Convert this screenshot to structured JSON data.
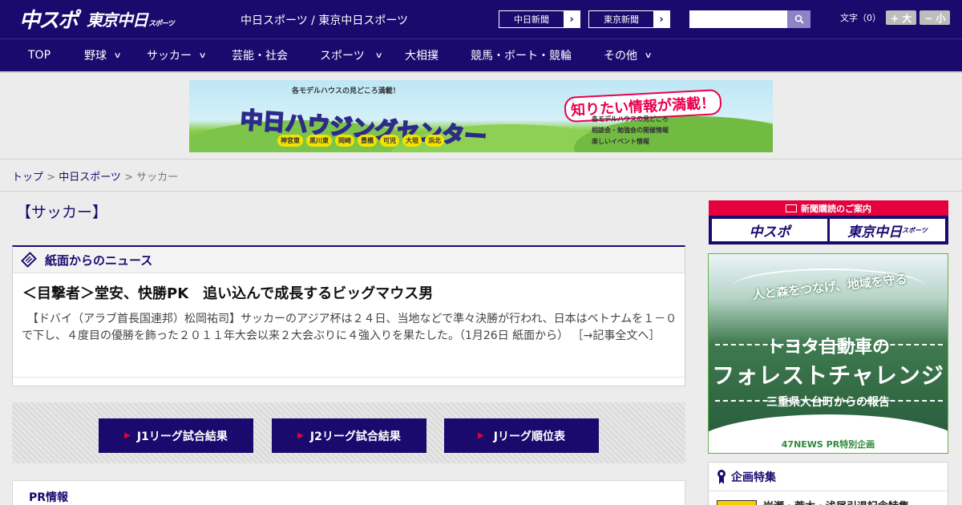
{
  "header": {
    "logo_main": "中スポ",
    "logo_tokyo": "東京中日",
    "logo_tokyo_small": "スポーツ",
    "site_links": "中日スポーツ / 東京中日スポーツ",
    "paper_buttons": [
      "中日新聞",
      "東京新聞"
    ],
    "search_placeholder": "",
    "font_size_label": "文字（0）",
    "font_bigger": "+ 大",
    "font_smaller": "− 小"
  },
  "nav": {
    "items": [
      {
        "label": "TOP",
        "has_dropdown": false
      },
      {
        "label": "野球",
        "has_dropdown": true
      },
      {
        "label": "サッカー",
        "has_dropdown": true
      },
      {
        "label": "芸能・社会",
        "has_dropdown": false
      },
      {
        "label": "スポーツ",
        "has_dropdown": true
      },
      {
        "label": "大相撲",
        "has_dropdown": false
      },
      {
        "label": "競馬・ボート・競輪",
        "has_dropdown": false
      },
      {
        "label": "その他",
        "has_dropdown": true
      }
    ]
  },
  "banner": {
    "subtitle": "各モデルハウスの見どころ満載！",
    "title": "中日ハウジングセンター",
    "catch": "知りたい情報が満載！",
    "cities": [
      "神宮東",
      "黒川東",
      "岡崎",
      "豊橋",
      "可児",
      "大垣",
      "浜北"
    ],
    "info_lines": [
      "各モデルハウスの見どころ",
      "相談会・勉強会の開催情報",
      "楽しいイベント情報"
    ]
  },
  "breadcrumb": {
    "top": "トップ",
    "sep": " > ",
    "parent": "中日スポーツ",
    "current": "サッカー"
  },
  "main": {
    "page_title": "【サッカー】",
    "news_section_title": "紙面からのニュース",
    "article_title": "＜目撃者＞堂安、快勝PK　追い込んで成長するビッグマウス男",
    "article_body": "　【ドバイ（アラブ首長国連邦）松岡祐司】サッカーのアジア杯は２４日、当地などで準々決勝が行われ、日本はベトナムを１－０で下し、４度目の優勝を飾った２０１１年大会以来２大会ぶりに４強入りを果たした。（1月26日 紙面から）",
    "article_more": "［→記事全文へ］",
    "jleague_buttons": [
      "J1リーグ試合結果",
      "J2リーグ試合結果",
      "Jリーグ順位表"
    ],
    "pr_title": "PR情報"
  },
  "sidebar": {
    "subscribe_head": "新聞購読のご案内",
    "subscribe_logos": [
      "中スポ",
      "東京中日"
    ],
    "subscribe_logo_small": "スポーツ",
    "forest_ad": {
      "ribbon": "人と森をつなげ、地域を守る",
      "company": "トヨタ自動車の",
      "headline": "フォレストチャレンジ",
      "report": "三重県大台町からの報告",
      "footer": "47NEWS PR特別企画"
    },
    "feature_title": "企画特集",
    "feature_item": "岩瀬・荒木・浅尾引退記念特集"
  },
  "colors": {
    "brand_navy": "#1b0a6e",
    "accent_red": "#e6003e",
    "background": "#ececec"
  }
}
